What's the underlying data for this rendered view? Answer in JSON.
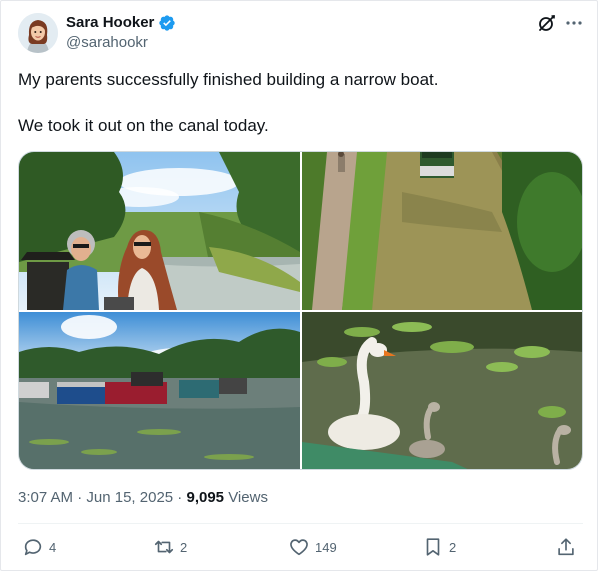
{
  "user": {
    "display_name": "Sara Hooker",
    "handle": "@sarahookr",
    "verified": true,
    "avatar_icon": "cartoon-avatar"
  },
  "header_icons": {
    "grok": "grok-icon",
    "more": "more-icon"
  },
  "tweet": {
    "text": "My parents successfully finished building a narrow boat.\n\nWe took it out on the canal today."
  },
  "media": {
    "photos": [
      {
        "subject": "two-women-on-boat"
      },
      {
        "subject": "boat-on-canal-towpath"
      },
      {
        "subject": "moored-narrowboats-marina"
      },
      {
        "subject": "swans-and-lily-pads"
      }
    ]
  },
  "meta": {
    "time": "3:07 AM",
    "separator": " · ",
    "date": "Jun 15, 2025",
    "views_count": "9,095",
    "views_label": " Views"
  },
  "actions": {
    "replies": "4",
    "reposts": "2",
    "likes": "149",
    "bookmarks": "2"
  },
  "colors": {
    "verified_blue": "#1d9bf0",
    "secondary_text": "#536471",
    "primary_text": "#0f1419"
  }
}
